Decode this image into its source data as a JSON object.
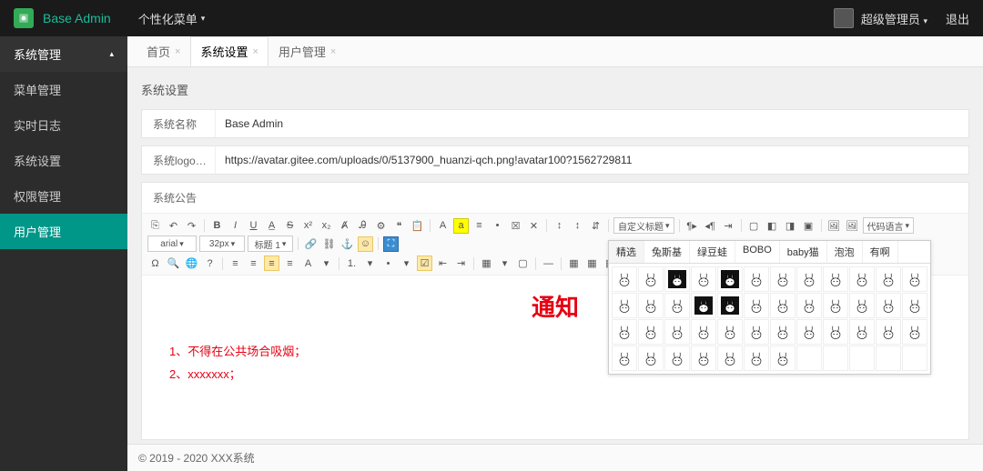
{
  "header": {
    "brand": "Base Admin",
    "custom_menu": "个性化菜单",
    "user_label": "超级管理员",
    "logout": "退出"
  },
  "sidebar": {
    "header": "系统管理",
    "items": [
      "菜单管理",
      "实时日志",
      "系统设置",
      "权限管理",
      "用户管理"
    ],
    "active_index": 4
  },
  "tabs": {
    "items": [
      "首页",
      "系统设置",
      "用户管理"
    ],
    "active_index": 1
  },
  "panel": {
    "title": "系统设置",
    "system_name_label": "系统名称",
    "system_name_value": "Base Admin",
    "system_logo_label": "系统logo…",
    "system_logo_value": "https://avatar.gitee.com/uploads/0/5137900_huanzi-qch.png!avatar100?1562729811",
    "announce_label": "系统公告"
  },
  "toolbar": {
    "selects": {
      "lang": "代码语言",
      "font": "arial",
      "size": "32px",
      "heading": "标题 1",
      "custom_title": "自定义标题"
    }
  },
  "notice": {
    "title": "通知",
    "lines": [
      "1、不得在公共场合吸烟；",
      "2、xxxxxxx；"
    ]
  },
  "emotion": {
    "tabs": [
      "精选",
      "兔斯基",
      "绿豆蛙",
      "BOBO",
      "baby猫",
      "泡泡",
      "有啊"
    ],
    "active_tab": 0,
    "rows": 4,
    "cols": 12,
    "filled": 43
  },
  "footer": {
    "text": "© 2019 - 2020 XXX系统"
  }
}
